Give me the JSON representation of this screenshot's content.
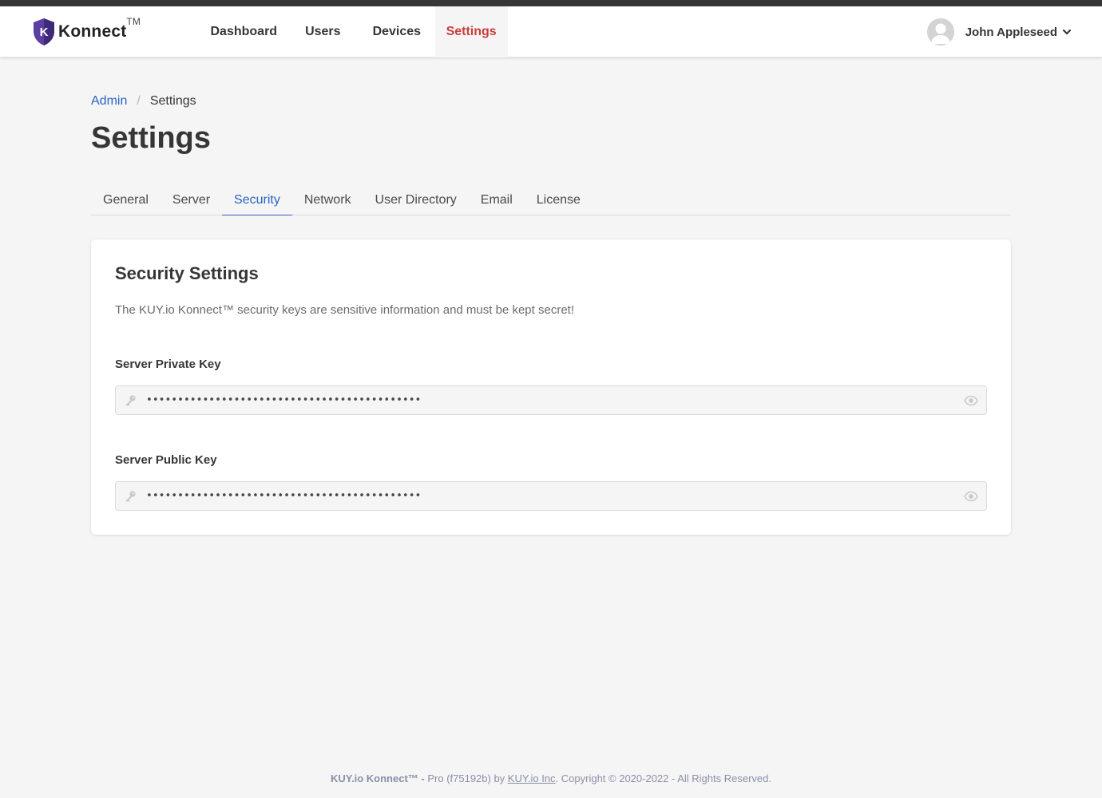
{
  "brand": {
    "logo_letter": "K",
    "name": "Konnect",
    "tm": "TM",
    "colors": {
      "shield": "#5b3fa3",
      "shield_dark": "#3f2a7a"
    }
  },
  "nav": {
    "items": [
      {
        "label": "Dashboard"
      },
      {
        "label": "Users"
      },
      {
        "label": "Devices"
      },
      {
        "label": "Settings",
        "active": true
      }
    ]
  },
  "user": {
    "name": "John Appleseed",
    "avatar_icon": "user-avatar-icon",
    "menu_icon": "chevron-down-icon"
  },
  "breadcrumb": {
    "parent": "Admin",
    "separator": "/",
    "current": "Settings"
  },
  "page": {
    "title": "Settings"
  },
  "tabs": [
    {
      "label": "General"
    },
    {
      "label": "Server"
    },
    {
      "label": "Security",
      "active": true
    },
    {
      "label": "Network"
    },
    {
      "label": "User Directory"
    },
    {
      "label": "Email"
    },
    {
      "label": "License"
    }
  ],
  "security": {
    "title": "Security Settings",
    "description": "The KUY.io Konnect™ security keys are sensitive information and must be kept secret!",
    "private_key": {
      "label": "Server Private Key",
      "value": "••••••••••••••••••••••••••••••••••••••••••••",
      "leading_icon": "key-icon",
      "trailing_icon": "eye-icon"
    },
    "public_key": {
      "label": "Server Public Key",
      "value": "••••••••••••••••••••••••••••••••••••••••••••",
      "leading_icon": "key-icon",
      "trailing_icon": "eye-icon"
    }
  },
  "footer": {
    "product": "KUY.io Konnect™ -",
    "edition": " Pro (f75192b) by ",
    "company": "KUY.io Inc",
    "copyright": ". Copyright © 2020-2022 - All Rights Reserved."
  },
  "colors": {
    "accent": "#2a62c4",
    "active_nav": "#cc3d3d",
    "topbar": "#363636",
    "background": "#f5f5f5"
  }
}
